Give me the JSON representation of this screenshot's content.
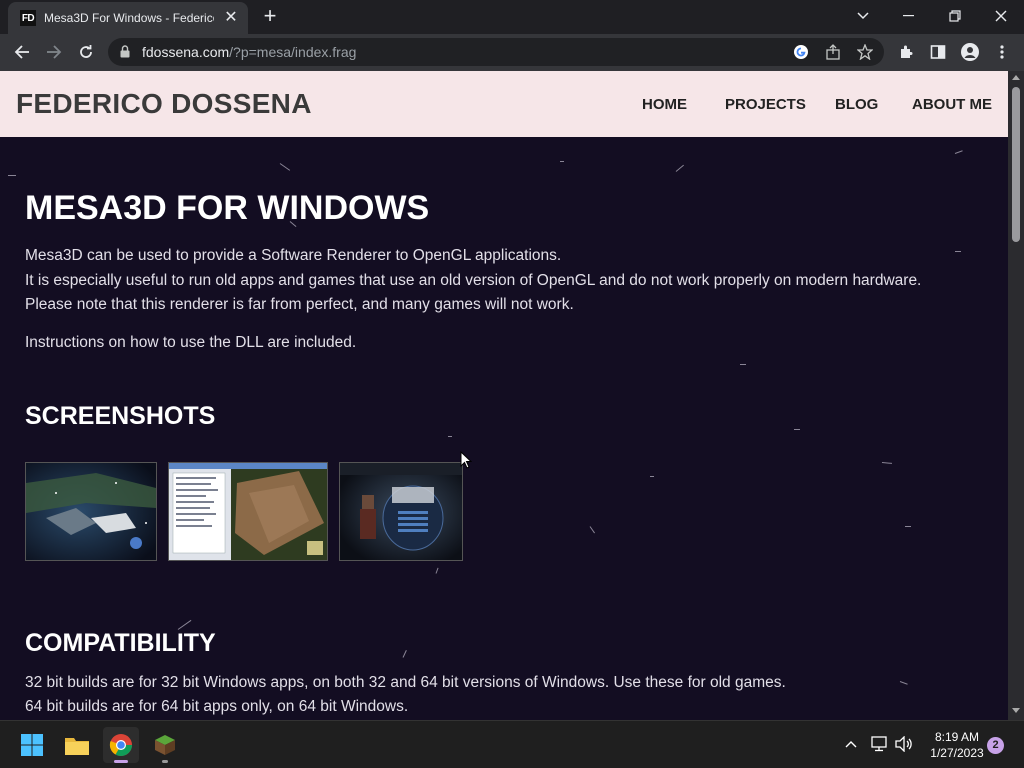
{
  "browser": {
    "tab_title": "Mesa3D For Windows - Federico Dossena",
    "favicon_text": "FD",
    "url_domain": "fdossena.com",
    "url_path": "/?p=mesa/index.frag"
  },
  "site": {
    "logo": "FEDERICO DOSSENA",
    "nav": [
      "HOME",
      "PROJECTS",
      "BLOG",
      "ABOUT ME"
    ],
    "header_bg": "#f6e6e8",
    "page_bg": "#130d22"
  },
  "content": {
    "title": "MESA3D FOR WINDOWS",
    "intro": [
      "Mesa3D can be used to provide a Software Renderer to OpenGL applications.",
      "It is especially useful to run old apps and games that use an old version of OpenGL and do not work properly on modern hardware.",
      "Please note that this renderer is far from perfect, and many games will not work."
    ],
    "instructions": "Instructions on how to use the DLL are included.",
    "screenshots_heading": "SCREENSHOTS",
    "compat_heading": "COMPATIBILITY",
    "compat": [
      "32 bit builds are for 32 bit Windows apps, on both 32 and 64 bit versions of Windows. Use these for old games.",
      "64 bit builds are for 64 bit apps only, on 64 bit Windows."
    ]
  },
  "taskbar": {
    "time": "8:19 AM",
    "date": "1/27/2023",
    "notifications": "2"
  }
}
